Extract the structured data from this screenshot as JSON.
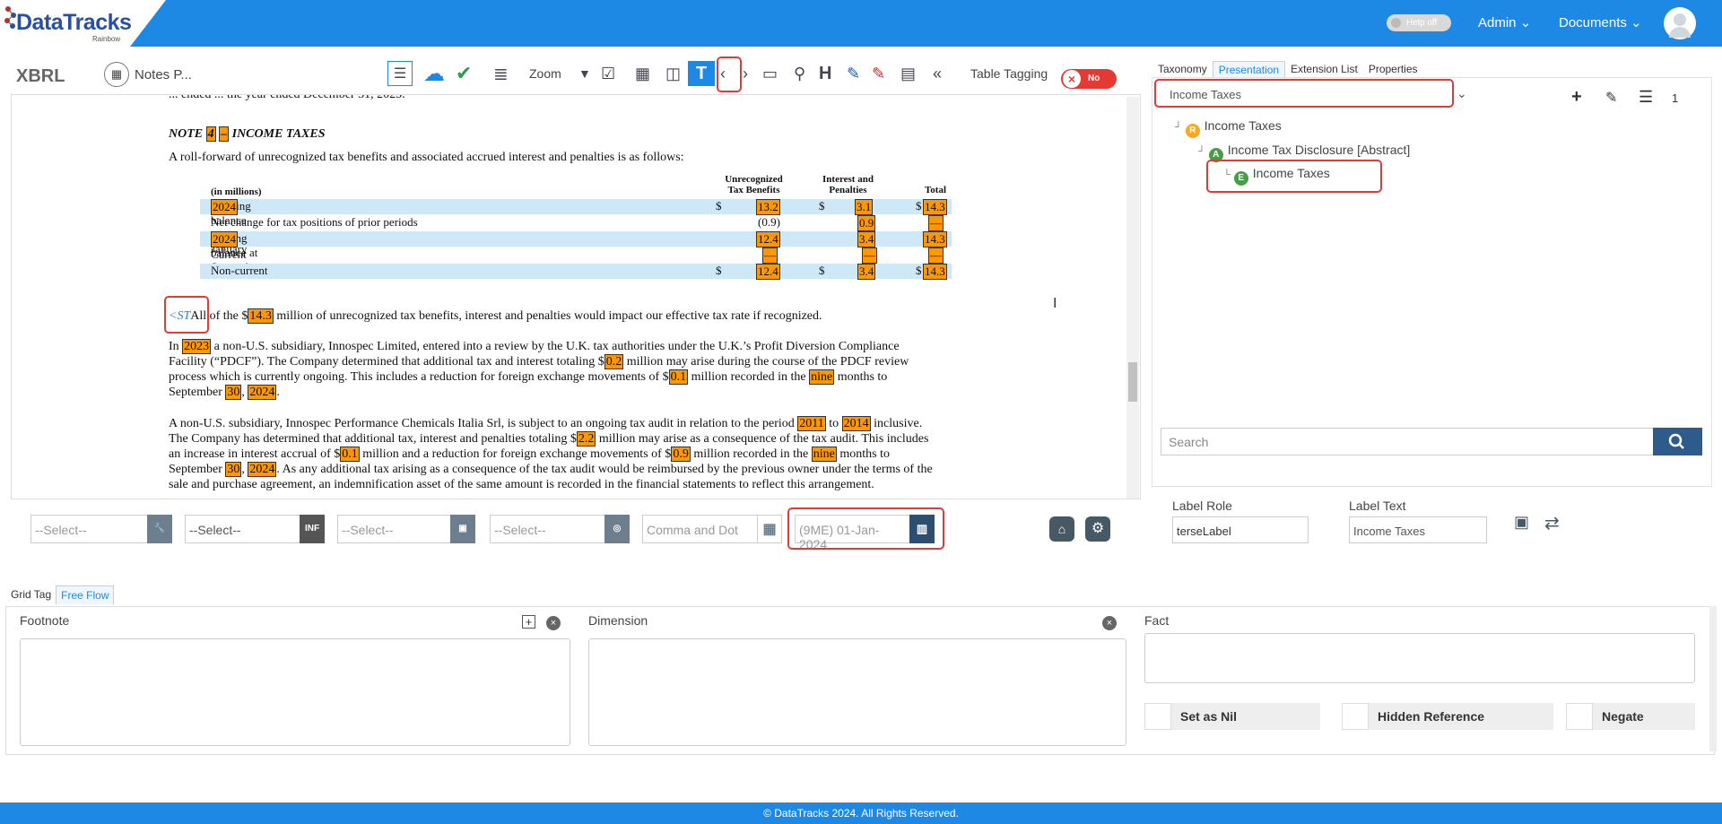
{
  "app": {
    "logo": "DataTracks",
    "logo_sub": "Rainbow",
    "help": "Help off",
    "nav": [
      "Admin",
      "Documents"
    ]
  },
  "toolbar": {
    "xbrl": "XBRL",
    "notes": "Notes P...",
    "zoom": "Zoom",
    "table_tagging": "Table Tagging",
    "toggle": "No"
  },
  "document": {
    "prev_line": "... ended ... the year ended December 31, 2023.",
    "note_title_pre": "NOTE ",
    "note_num": "4",
    "note_dash": "–",
    "note_title": " INCOME TAXES",
    "intro": "A roll-forward of unrecognized tax benefits and associated accrued interest and penalties is as follows:",
    "table": {
      "headers": [
        "Unrecognized\nTax Benefits",
        "Interest and\nPenalties",
        "Total"
      ],
      "unit": "(in millions)",
      "rows": [
        {
          "label_pre": "Opening balance at January ",
          "d1": "1",
          "sep": ", ",
          "d2": "2024",
          "c1": "13.2",
          "c2": "3.1",
          "c3": "14.3",
          "dollar": true
        },
        {
          "label_pre": "Net change for tax positions of prior periods",
          "c1": "(0.9)",
          "c2": "0.9",
          "c3": "—"
        },
        {
          "label_pre": "Closing balance at September ",
          "d1": "30",
          "sep": ", ",
          "d2": "2024",
          "c1": "12.4",
          "c2": "3.4",
          "c3": "14.3"
        },
        {
          "label_pre": "Current",
          "c1": "—",
          "c2": "—",
          "c3": "—"
        },
        {
          "label_pre": "Non-current",
          "c1": "12.4",
          "c2": "3.4",
          "c3": "14.3",
          "dollar": true
        }
      ]
    },
    "st_marker": "<ST",
    "p1_a": "All of the $",
    "p1_v": "14.3",
    "p1_b": " million of unrecognized tax benefits, interest and penalties would impact our effective tax rate if recognized.",
    "p2": {
      "a": "In ",
      "y": "2023",
      "b": " a non-U.S. subsidiary, Innospec Limited, entered into a review by the U.K. tax authorities under the U.K.’s Profit Diversion Compliance",
      "l2a": "Facility (“PDCF”). The Company determined that additional tax and interest totaling $",
      "v1": "0.2",
      "l2b": " million may arise during the course of the PDCF review",
      "l3a": "process which is currently ongoing. This includes a reduction for foreign exchange movements of $",
      "v2": "0.1",
      "l3b": " million recorded in the ",
      "n": "nine",
      "l3c": " months to",
      "l4a": "September ",
      "d": "30",
      "l4b": ", ",
      "y2": "2024",
      "l4c": "."
    },
    "p3": {
      "a": "A non-U.S. subsidiary, Innospec Performance Chemicals Italia Srl, is subject to an ongoing tax audit in relation to the period ",
      "y1": "2011",
      "to": " to ",
      "y2": "2014",
      "b": " inclusive.",
      "l2a": "The Company has determined that additional tax, interest and penalties totaling $",
      "v1": "2.2",
      "l2b": " million may arise as a consequence of the tax audit. This includes",
      "l3a": "an increase in interest accrual of $",
      "v2": "0.1",
      "l3b": " million and a reduction for foreign exchange movements of $",
      "v3": "0.9",
      "l3c": " million recorded in the ",
      "n": "nine",
      "l3d": " months to",
      "l4a": "September ",
      "d": "30",
      "l4b": ", ",
      "y3": "2024",
      "l4c": ". As any additional tax arising as a consequence of the tax audit would be reimbursed by the previous owner under the terms of the",
      "l5": "sale and purchase agreement, an indemnification asset of the same amount is recorded in the financial statements to reflect this arrangement."
    }
  },
  "right_panel": {
    "tabs": [
      "Taxonomy",
      "Presentation",
      "Extension List",
      "Properties"
    ],
    "selected": "Income Taxes",
    "count": "1",
    "tree": [
      {
        "badge": "R",
        "label": "Income Taxes",
        "color": "#f9a825"
      },
      {
        "badge": "A",
        "label": "Income Tax Disclosure [Abstract]",
        "color": "#43a047"
      },
      {
        "badge": "E",
        "label": "Income Taxes",
        "color": "#43a047"
      }
    ],
    "search_placeholder": "Search"
  },
  "selectors": {
    "s1": "--Select--",
    "s2": "--Select--",
    "s3": "--Select--",
    "s4": "--Select--",
    "format": "Comma and Dot",
    "period": "(9ME) 01-Jan-2024",
    "inf": "INF"
  },
  "label": {
    "role_label": "Label Role",
    "role_value": "terseLabel",
    "text_label": "Label Text",
    "text_value": "Income Taxes"
  },
  "bottom": {
    "tabs": [
      "Grid Tag",
      "Free Flow"
    ],
    "footnote": "Footnote",
    "dimension": "Dimension",
    "fact": "Fact",
    "nil": "Set as Nil",
    "hidden": "Hidden Reference",
    "negate": "Negate"
  },
  "footer": "© DataTracks 2024. All Rights Reserved."
}
